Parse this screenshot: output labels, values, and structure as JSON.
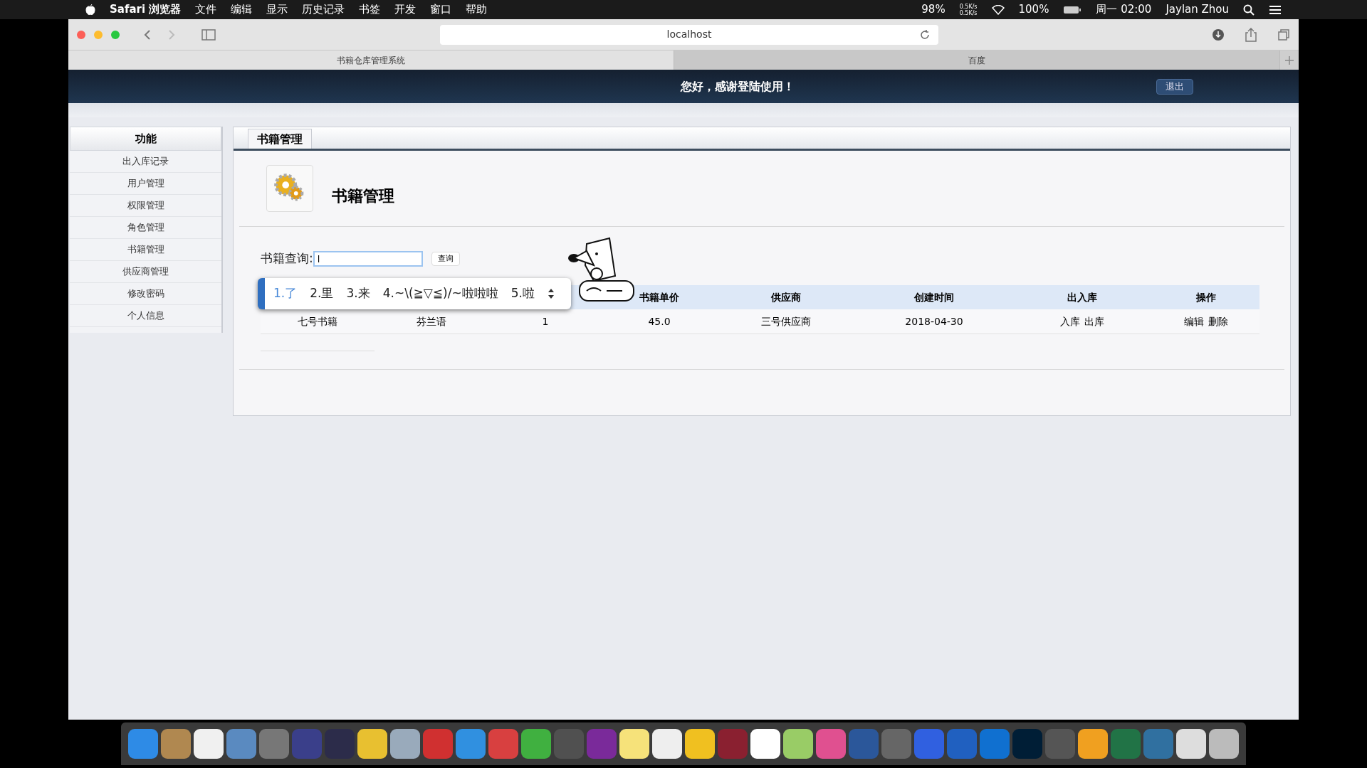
{
  "menu_bar": {
    "app": "Safari 浏览器",
    "menus": [
      "文件",
      "编辑",
      "显示",
      "历史记录",
      "书签",
      "开发",
      "窗口",
      "帮助"
    ],
    "battery_small": "98%",
    "net_up": "0.5K/s",
    "net_down": "0.5K/s",
    "battery": "100%",
    "clock": "周一 02:00",
    "user": "Jaylan Zhou"
  },
  "browser": {
    "address": "localhost",
    "tabs": [
      {
        "label": "书籍仓库管理系统",
        "selected": true
      },
      {
        "label": "百度",
        "selected": false
      }
    ]
  },
  "header": {
    "greeting": "您好，感谢登陆使用！",
    "logout": "退出"
  },
  "sidebar": {
    "title": "功能",
    "items": [
      "出入库记录",
      "用户管理",
      "权限管理",
      "角色管理",
      "书籍管理",
      "供应商管理",
      "修改密码",
      "个人信息"
    ]
  },
  "panel": {
    "tab": "书籍管理",
    "title": "书籍管理",
    "search": {
      "label": "书籍查询:",
      "value": "l",
      "button": "查询"
    },
    "ime": {
      "candidates": [
        {
          "label": "1.了",
          "selected": true
        },
        {
          "label": "2.里",
          "selected": false
        },
        {
          "label": "3.来",
          "selected": false
        },
        {
          "label": "4.~\\(≧▽≦)/~啦啦啦",
          "selected": false
        },
        {
          "label": "5.啦",
          "selected": false
        }
      ]
    },
    "table": {
      "columns": [
        "",
        "",
        "",
        "书籍单价",
        "供应商",
        "创建时间",
        "出入库",
        "操作"
      ],
      "rows": [
        {
          "cells": [
            "七号书籍",
            "芬兰语",
            "1",
            "45.0",
            "三号供应商",
            "2018-04-30"
          ],
          "stock_links": [
            "入库",
            "出库"
          ],
          "actions": [
            "编辑",
            "删除"
          ]
        }
      ]
    }
  }
}
